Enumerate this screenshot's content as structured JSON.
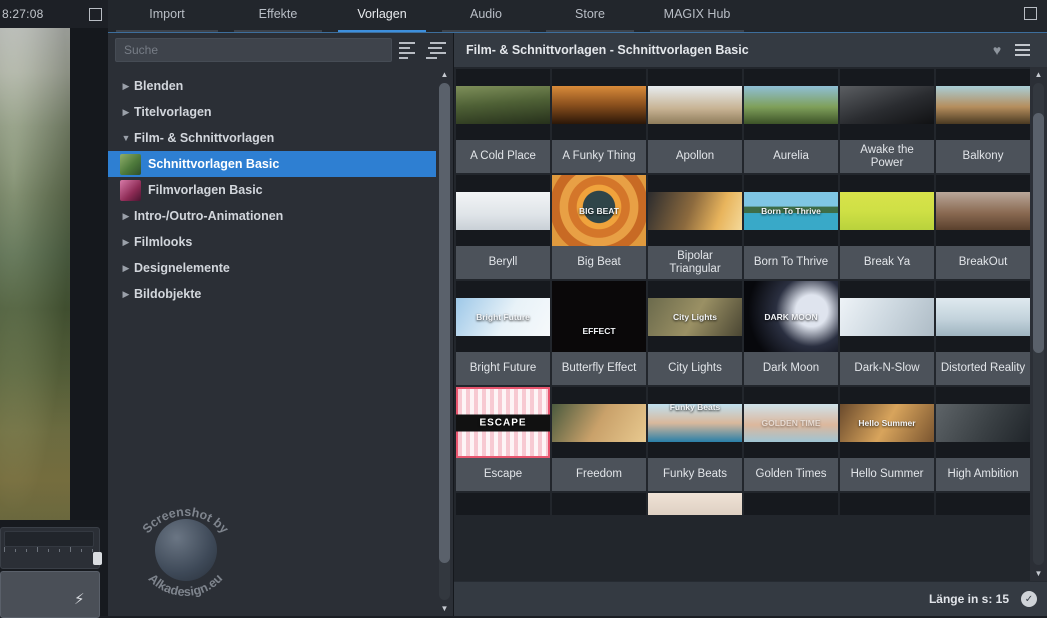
{
  "left_panel": {
    "timecode": "8:27:08",
    "maximize_icon": "square-icon",
    "bolt_icon": "lightning-bolt-icon"
  },
  "tabs": [
    {
      "label": "Import",
      "active": false
    },
    {
      "label": "Effekte",
      "active": false
    },
    {
      "label": "Vorlagen",
      "active": true
    },
    {
      "label": "Audio",
      "active": false
    },
    {
      "label": "Store",
      "active": false
    },
    {
      "label": "MAGIX Hub",
      "active": false
    }
  ],
  "window_button": "restore-window-icon",
  "search": {
    "value": "",
    "placeholder": "Suche",
    "icon_list": "list-view-icon",
    "icon_sort": "sort-list-icon"
  },
  "tree": [
    {
      "label": "Blenden",
      "state": "collapsed",
      "level": 0,
      "selected": false,
      "thumb": null
    },
    {
      "label": "Titelvorlagen",
      "state": "collapsed",
      "level": 0,
      "selected": false,
      "thumb": null
    },
    {
      "label": "Film- & Schnittvorlagen",
      "state": "expanded",
      "level": 0,
      "selected": false,
      "thumb": null
    },
    {
      "label": "Schnittvorlagen Basic",
      "state": "leaf",
      "level": 1,
      "selected": true,
      "thumb": "green"
    },
    {
      "label": "Filmvorlagen Basic",
      "state": "leaf",
      "level": 1,
      "selected": false,
      "thumb": "pink"
    },
    {
      "label": "Intro-/Outro-Animationen",
      "state": "collapsed",
      "level": 0,
      "selected": false,
      "thumb": null
    },
    {
      "label": "Filmlooks",
      "state": "collapsed",
      "level": 0,
      "selected": false,
      "thumb": null
    },
    {
      "label": "Designelemente",
      "state": "collapsed",
      "level": 0,
      "selected": false,
      "thumb": null
    },
    {
      "label": "Bildobjekte",
      "state": "collapsed",
      "level": 0,
      "selected": false,
      "thumb": null
    }
  ],
  "breadcrumb": {
    "title": "Film- & Schnittvorlagen - Schnittvorlagen Basic",
    "favorite_icon": "heart-icon",
    "menu_icon": "hamburger-menu-icon"
  },
  "grid": {
    "rows": [
      [
        {
          "label": "A Cold Place",
          "overlay": ""
        },
        {
          "label": "A Funky Thing",
          "overlay": ""
        },
        {
          "label": "Apollon",
          "overlay": ""
        },
        {
          "label": "Aurelia",
          "overlay": ""
        },
        {
          "label": "Awake the Power",
          "overlay": ""
        },
        {
          "label": "Balkony",
          "overlay": ""
        }
      ],
      [
        {
          "label": "Beryll",
          "overlay": ""
        },
        {
          "label": "Big Beat",
          "overlay": "BIG BEAT"
        },
        {
          "label": "Bipolar Triangular",
          "overlay": ""
        },
        {
          "label": "Born To Thrive",
          "overlay": "Born To Thrive"
        },
        {
          "label": "Break Ya",
          "overlay": ""
        },
        {
          "label": "BreakOut",
          "overlay": ""
        }
      ],
      [
        {
          "label": "Bright Future",
          "overlay": "Bright Future"
        },
        {
          "label": "Butterfly Effect",
          "overlay": "EFFECT"
        },
        {
          "label": "City Lights",
          "overlay": "City Lights"
        },
        {
          "label": "Dark Moon",
          "overlay": "DARK MOON"
        },
        {
          "label": "Dark-N-Slow",
          "overlay": ""
        },
        {
          "label": "Distorted Reality",
          "overlay": ""
        }
      ],
      [
        {
          "label": "Escape",
          "overlay": "ESCAPE"
        },
        {
          "label": "Freedom",
          "overlay": ""
        },
        {
          "label": "Funky Beats",
          "overlay": "Funky Beats"
        },
        {
          "label": "Golden Times",
          "overlay": "GOLDEN TIME"
        },
        {
          "label": "Hello Summer",
          "overlay": "Hello Summer"
        },
        {
          "label": "High Ambition",
          "overlay": ""
        }
      ]
    ]
  },
  "scrollbars": {
    "up_arrow": "chevron-up-icon",
    "down_arrow": "chevron-down-icon"
  },
  "status": {
    "length_label": "Länge in s: 15",
    "confirm_icon": "checkmark-icon"
  },
  "watermark": {
    "top_text": "Screenshot by",
    "bottom_text": "Alkadesign.eu"
  },
  "colors": {
    "accent": "#2e7fd2",
    "panel": "#2b2f36",
    "header": "#343a42",
    "cell_label": "#4c525a"
  }
}
